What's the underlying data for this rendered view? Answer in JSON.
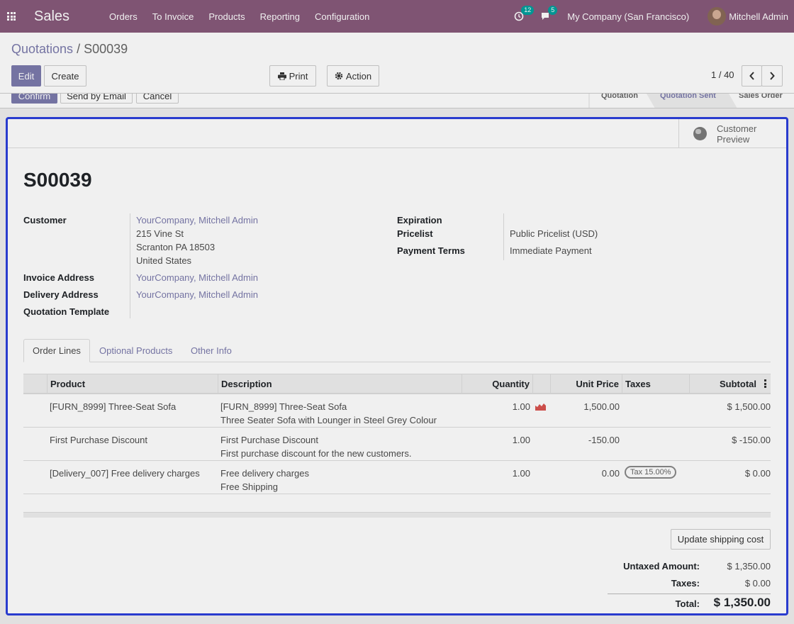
{
  "navbar": {
    "app_name": "Sales",
    "menu": [
      "Orders",
      "To Invoice",
      "Products",
      "Reporting",
      "Configuration"
    ],
    "activity_count": "12",
    "message_count": "5",
    "company": "My Company (San Francisco)",
    "user": "Mitchell Admin"
  },
  "breadcrumb": {
    "parent": "Quotations",
    "separator": "/",
    "current": "S00039"
  },
  "toolbar": {
    "edit": "Edit",
    "create": "Create",
    "print": "Print",
    "action": "Action",
    "pager": "1 / 40"
  },
  "statusbar": {
    "confirm": "Confirm",
    "send_email": "Send by Email",
    "cancel": "Cancel",
    "stages": [
      "Quotation",
      "Quotation Sent",
      "Sales Order"
    ],
    "active_stage": "Quotation Sent"
  },
  "preview": {
    "line1": "Customer",
    "line2": "Preview"
  },
  "record": {
    "name": "S00039",
    "customer_label": "Customer",
    "customer": "YourCompany, Mitchell Admin",
    "address1": "215 Vine St",
    "address2": "Scranton PA 18503",
    "address3": "United States",
    "invoice_label": "Invoice Address",
    "invoice_address": "YourCompany, Mitchell Admin",
    "delivery_label": "Delivery Address",
    "delivery_address": "YourCompany, Mitchell Admin",
    "template_label": "Quotation Template",
    "expiration_label": "Expiration",
    "pricelist_label": "Pricelist",
    "pricelist": "Public Pricelist (USD)",
    "terms_label": "Payment Terms",
    "terms": "Immediate Payment"
  },
  "tabs": [
    "Order Lines",
    "Optional Products",
    "Other Info"
  ],
  "table": {
    "headers": {
      "product": "Product",
      "description": "Description",
      "quantity": "Quantity",
      "unit_price": "Unit Price",
      "taxes": "Taxes",
      "subtotal": "Subtotal"
    },
    "rows": [
      {
        "product": "[FURN_8999] Three-Seat Sofa",
        "desc1": "[FURN_8999] Three-Seat Sofa",
        "desc2": "Three Seater Sofa with Lounger in Steel Grey Colour",
        "qty": "1.00",
        "price": "1,500.00",
        "tax": "",
        "subtotal": "$ 1,500.00"
      },
      {
        "product": "First Purchase Discount",
        "desc1": "First Purchase Discount",
        "desc2": "First purchase discount for the new customers.",
        "qty": "1.00",
        "price": "-150.00",
        "tax": "",
        "subtotal": "$ -150.00"
      },
      {
        "product": "[Delivery_007] Free delivery charges",
        "desc1": "Free delivery charges",
        "desc2": "Free Shipping",
        "qty": "1.00",
        "price": "0.00",
        "tax": "Tax 15.00%",
        "subtotal": "$ 0.00"
      }
    ]
  },
  "update_shipping": "Update shipping cost",
  "totals": {
    "untaxed_label": "Untaxed Amount:",
    "untaxed": "$ 1,350.00",
    "taxes_label": "Taxes:",
    "taxes": "$ 0.00",
    "total_label": "Total:",
    "total": "$ 1,350.00"
  },
  "colors": {
    "brand": "#875a7b",
    "link": "#7c7bad",
    "focus_border": "#2c3fdb",
    "forecast_icon": "#d9534f"
  }
}
